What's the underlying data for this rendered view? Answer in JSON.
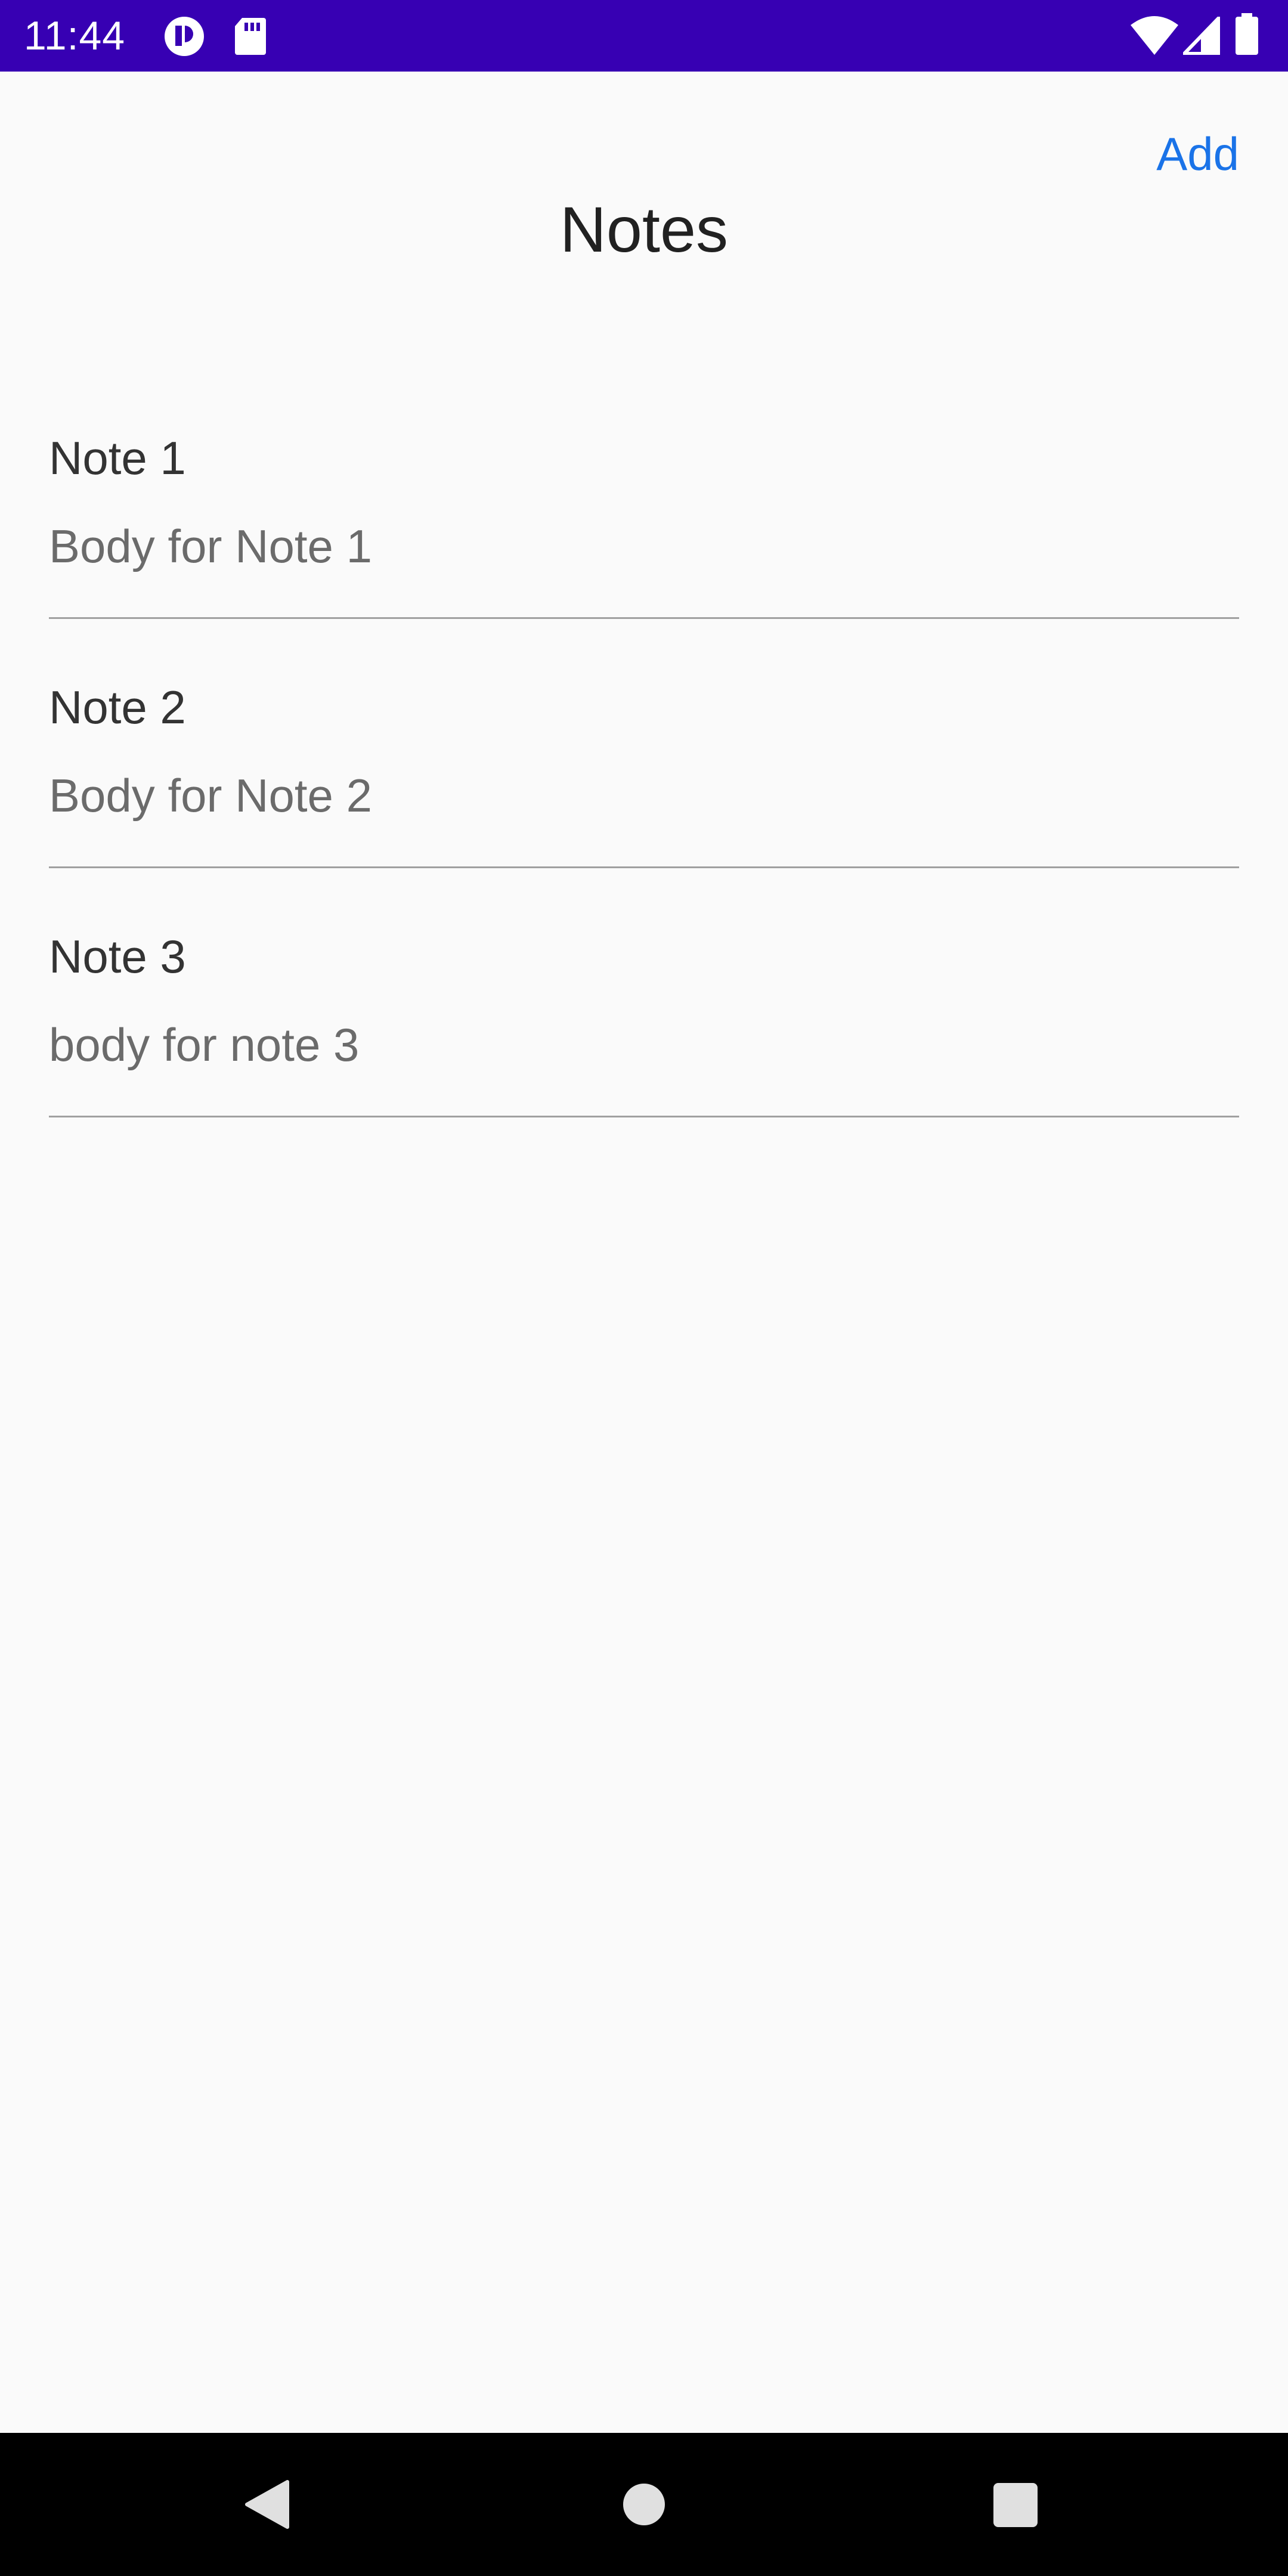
{
  "status_bar": {
    "time": "11:44",
    "icons": [
      "app-notification-icon",
      "sd-card-icon",
      "wifi-icon",
      "cellular-signal-icon",
      "battery-icon"
    ]
  },
  "header": {
    "add_label": "Add",
    "title": "Notes"
  },
  "notes": [
    {
      "title": "Note 1",
      "body": "Body for Note 1"
    },
    {
      "title": "Note 2",
      "body": "Body for Note 2"
    },
    {
      "title": "Note 3",
      "body": "body for note 3"
    }
  ],
  "nav_bar": {
    "buttons": [
      "back-icon",
      "home-icon",
      "recents-icon"
    ]
  },
  "colors": {
    "status_bar": "#3700b3",
    "accent": "#1a73e8",
    "background": "#fafafa",
    "nav_bar": "#000000"
  }
}
